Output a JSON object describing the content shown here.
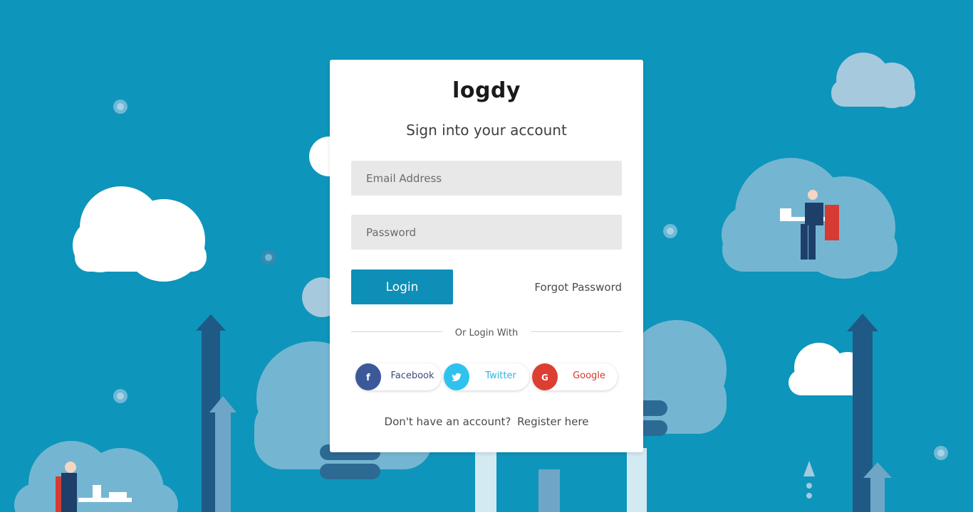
{
  "brand": {
    "logo": "logdy"
  },
  "form": {
    "title": "Sign into your account",
    "email_placeholder": "Email Address",
    "password_placeholder": "Password",
    "login_label": "Login",
    "forgot_label": "Forgot Password",
    "divider_text": "Or Login With"
  },
  "social": [
    {
      "label": "Facebook",
      "icon": "facebook-icon",
      "color": "#3b5998"
    },
    {
      "label": "Twitter",
      "icon": "twitter-icon",
      "color": "#2fc2ef"
    },
    {
      "label": "Google",
      "icon": "google-icon",
      "color": "#dd3e32"
    }
  ],
  "footer": {
    "prompt": "Don't have an account?",
    "register_label": "Register here"
  },
  "colors": {
    "background": "#0e95bb",
    "accent": "#0d8fb7",
    "card": "#ffffff"
  }
}
